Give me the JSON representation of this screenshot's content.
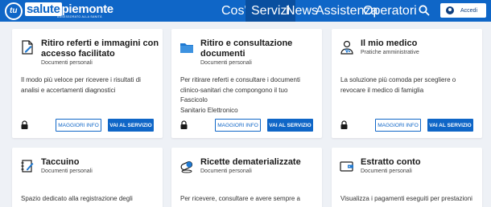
{
  "header": {
    "logo_symbol": "tu",
    "logo_word1": "salute",
    "logo_word2": "piemonte",
    "logo_sub": "ASSESSORATO ALLA SANITÀ",
    "nav": [
      "Cos'è",
      "Servizi",
      "News",
      "Assistenza",
      "Operatori"
    ],
    "active_nav": "Servizi",
    "search_icon": "search-icon",
    "access_label": "Accedi",
    "colors": {
      "brand": "#0f66c7",
      "active": "#0a4f9f"
    }
  },
  "cards": [
    {
      "icon": "document-edit-icon",
      "title_l1": "Ritiro referti e immagini con",
      "title_l2": "accesso facilitato",
      "category": "Documenti personali",
      "desc_l1": "Il modo più veloce per ricevere i risultati di",
      "desc_l2": "analisi e accertamenti diagnostici",
      "desc_l3": "",
      "info_label": "MAGGIORI INFO",
      "go_label": "VAI AL SERVIZIO"
    },
    {
      "icon": "folder-icon",
      "title_l1": "Ritiro e consultazione",
      "title_l2": "documenti",
      "category": "Documenti personali",
      "desc_l1": "Per ritirare referti e consultare i documenti",
      "desc_l2": "clinico-sanitari che compongono il tuo Fascicolo",
      "desc_l3": "Sanitario Elettronico",
      "info_label": "MAGGIORI INFO",
      "go_label": "VAI AL SERVIZIO"
    },
    {
      "icon": "doctor-icon",
      "title_l1": "Il mio medico",
      "title_l2": "",
      "category": "Pratiche amministrative",
      "desc_l1": "La soluzione più comoda per scegliere o",
      "desc_l2": "revocare il medico di famiglia",
      "desc_l3": "",
      "info_label": "MAGGIORI INFO",
      "go_label": "VAI AL SERVIZIO"
    },
    {
      "icon": "notebook-icon",
      "title_l1": "Taccuino",
      "category": "Documenti personali",
      "desc_l1": "Spazio dedicato alla registrazione degli"
    },
    {
      "icon": "pill-icon",
      "title_l1": "Ricette dematerializzate",
      "category": "Documenti personali",
      "desc_l1": "Per ricevere, consultare e avere sempre a"
    },
    {
      "icon": "wallet-icon",
      "title_l1": "Estratto conto",
      "category": "Documenti personali",
      "desc_l1": "Visualizza i pagamenti eseguiti per prestazioni"
    }
  ]
}
